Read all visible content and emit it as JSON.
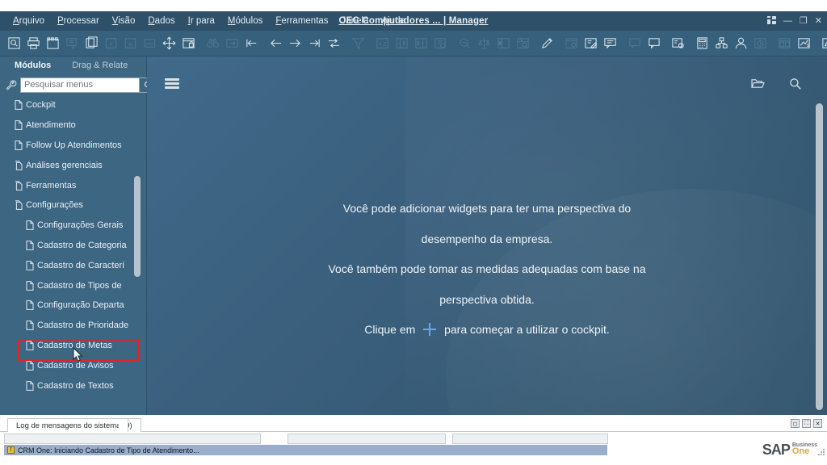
{
  "window": {
    "title": "OEC Computadores ... | Manager",
    "controls": [
      "grid-icon",
      "minimize-icon",
      "restore-icon",
      "close-icon"
    ]
  },
  "menubar": {
    "items": [
      {
        "label": "Arquivo",
        "accel": "A"
      },
      {
        "label": "Processar",
        "accel": "P"
      },
      {
        "label": "Visão",
        "accel": "V"
      },
      {
        "label": "Dados",
        "accel": "D"
      },
      {
        "label": "Ir para",
        "accel": "I"
      },
      {
        "label": "Módulos",
        "accel": "M"
      },
      {
        "label": "Ferramentas",
        "accel": "F"
      },
      {
        "label": "Janela",
        "accel": "J"
      },
      {
        "label": "Ajuda",
        "accel": "u"
      }
    ]
  },
  "toolbar": {
    "icons": [
      {
        "name": "find-icon",
        "enabled": true
      },
      {
        "name": "print-icon",
        "enabled": true
      },
      {
        "name": "print-preview-icon",
        "enabled": true
      },
      {
        "name": "email-icon",
        "enabled": false
      },
      {
        "name": "export-icon",
        "enabled": true
      },
      {
        "name": "excel-icon",
        "enabled": false
      },
      {
        "name": "word-icon",
        "enabled": false
      },
      {
        "name": "pdf-icon",
        "enabled": false
      },
      {
        "name": "move-icon",
        "enabled": true
      },
      {
        "name": "lock-screen-icon",
        "enabled": true
      },
      {
        "name": "binoculars-icon",
        "enabled": false
      },
      {
        "name": "next-record-icon",
        "enabled": false
      },
      {
        "name": "first-record-icon",
        "enabled": true
      },
      {
        "name": "previous-record-icon",
        "enabled": true
      },
      {
        "name": "next-record-arrow-icon",
        "enabled": true
      },
      {
        "name": "last-record-icon",
        "enabled": true
      },
      {
        "name": "toggle-view-icon",
        "enabled": true
      },
      {
        "name": "filter-icon",
        "enabled": false
      },
      {
        "name": "sort-icon",
        "enabled": false
      },
      {
        "name": "add-row-icon",
        "enabled": false
      },
      {
        "name": "duplicate-row-icon",
        "enabled": false
      },
      {
        "name": "document-info-icon",
        "enabled": false
      },
      {
        "name": "query-zoom-icon",
        "enabled": false
      },
      {
        "name": "balance-icon",
        "enabled": false
      },
      {
        "name": "split-view-icon",
        "enabled": false
      },
      {
        "name": "layout-search-icon",
        "enabled": false
      },
      {
        "name": "edit-pencil-icon",
        "enabled": true
      },
      {
        "name": "form-settings-icon",
        "enabled": false
      },
      {
        "name": "user-defined-fields-icon",
        "enabled": true
      },
      {
        "name": "messages-icon",
        "enabled": true
      },
      {
        "name": "reply-icon",
        "enabled": false
      },
      {
        "name": "alerts-icon",
        "enabled": true
      },
      {
        "name": "drag-relate-icon",
        "enabled": true
      },
      {
        "name": "calculator-icon",
        "enabled": true
      },
      {
        "name": "organization-chart-icon",
        "enabled": true
      },
      {
        "name": "user-icon",
        "enabled": true
      },
      {
        "name": "clock-icon",
        "enabled": false
      },
      {
        "name": "cockpit-widgets-icon",
        "enabled": false
      },
      {
        "name": "sales-opportunity-icon",
        "enabled": true
      },
      {
        "name": "notes-icon",
        "enabled": true
      },
      {
        "name": "browser-icon",
        "enabled": true
      },
      {
        "name": "help-icon",
        "enabled": true
      }
    ]
  },
  "sidebar": {
    "tabs": [
      {
        "label": "Módulos",
        "active": true
      },
      {
        "label": "Drag & Relate",
        "active": false
      }
    ],
    "search": {
      "placeholder": "Pesquisar menus",
      "value": "",
      "button_icon": "search-icon",
      "settings_icon": "wrench-icon"
    },
    "items": [
      {
        "label": "Cockpit",
        "level": 1,
        "icon": "module-icon"
      },
      {
        "label": "Atendimento",
        "level": 1,
        "icon": "module-icon"
      },
      {
        "label": "Follow Up Atendimentos",
        "level": 1,
        "icon": "module-icon"
      },
      {
        "label": "Análises gerenciais",
        "level": 1,
        "icon": "folder-icon"
      },
      {
        "label": "Ferramentas",
        "level": 1,
        "icon": "folder-icon"
      },
      {
        "label": "Configurações",
        "level": 1,
        "icon": "folder-icon"
      },
      {
        "label": "Configurações Gerais",
        "level": 2,
        "icon": "module-icon"
      },
      {
        "label": "Cadastro de Categoria",
        "level": 2,
        "icon": "module-icon"
      },
      {
        "label": "Cadastro de Caracterí",
        "level": 2,
        "icon": "module-icon"
      },
      {
        "label": "Cadastro de Tipos de ",
        "level": 2,
        "icon": "module-icon",
        "highlighted": true
      },
      {
        "label": "Configuração Departa",
        "level": 2,
        "icon": "module-icon"
      },
      {
        "label": "Cadastro de Prioridade",
        "level": 2,
        "icon": "module-icon"
      },
      {
        "label": "Cadastro de Metas",
        "level": 2,
        "icon": "module-icon"
      },
      {
        "label": "Cadastro de Avisos",
        "level": 2,
        "icon": "module-icon"
      },
      {
        "label": "Cadastro de Textos",
        "level": 2,
        "icon": "module-icon"
      }
    ],
    "highlight_color": "#ee1c23"
  },
  "cockpit": {
    "menu_icon": "hamburger-icon",
    "folder_icon": "folder-open-icon",
    "search_icon": "search-icon",
    "lines": [
      "Você pode adicionar widgets para ter uma perspectiva do",
      "desempenho da empresa.",
      "Você também pode tomar as medidas adequadas com base na",
      "perspectiva obtida."
    ],
    "cta_prefix": "Clique em",
    "cta_suffix": "para começar a utilizar o cockpit.",
    "plus_color": "#4cb6e8"
  },
  "bottom": {
    "log_tab": "Log de mensagens do sistema (9)",
    "pane_buttons": [
      "restore-icon",
      "maximize-icon",
      "close-icon"
    ],
    "status_message": "CRM One: Iniciando Cadastro de Tipo de Atendimento...",
    "status_icon": "warning-icon",
    "fields": [
      "",
      "",
      ""
    ],
    "brand": {
      "word": "SAP",
      "line1": "Business",
      "line2": "One"
    }
  }
}
